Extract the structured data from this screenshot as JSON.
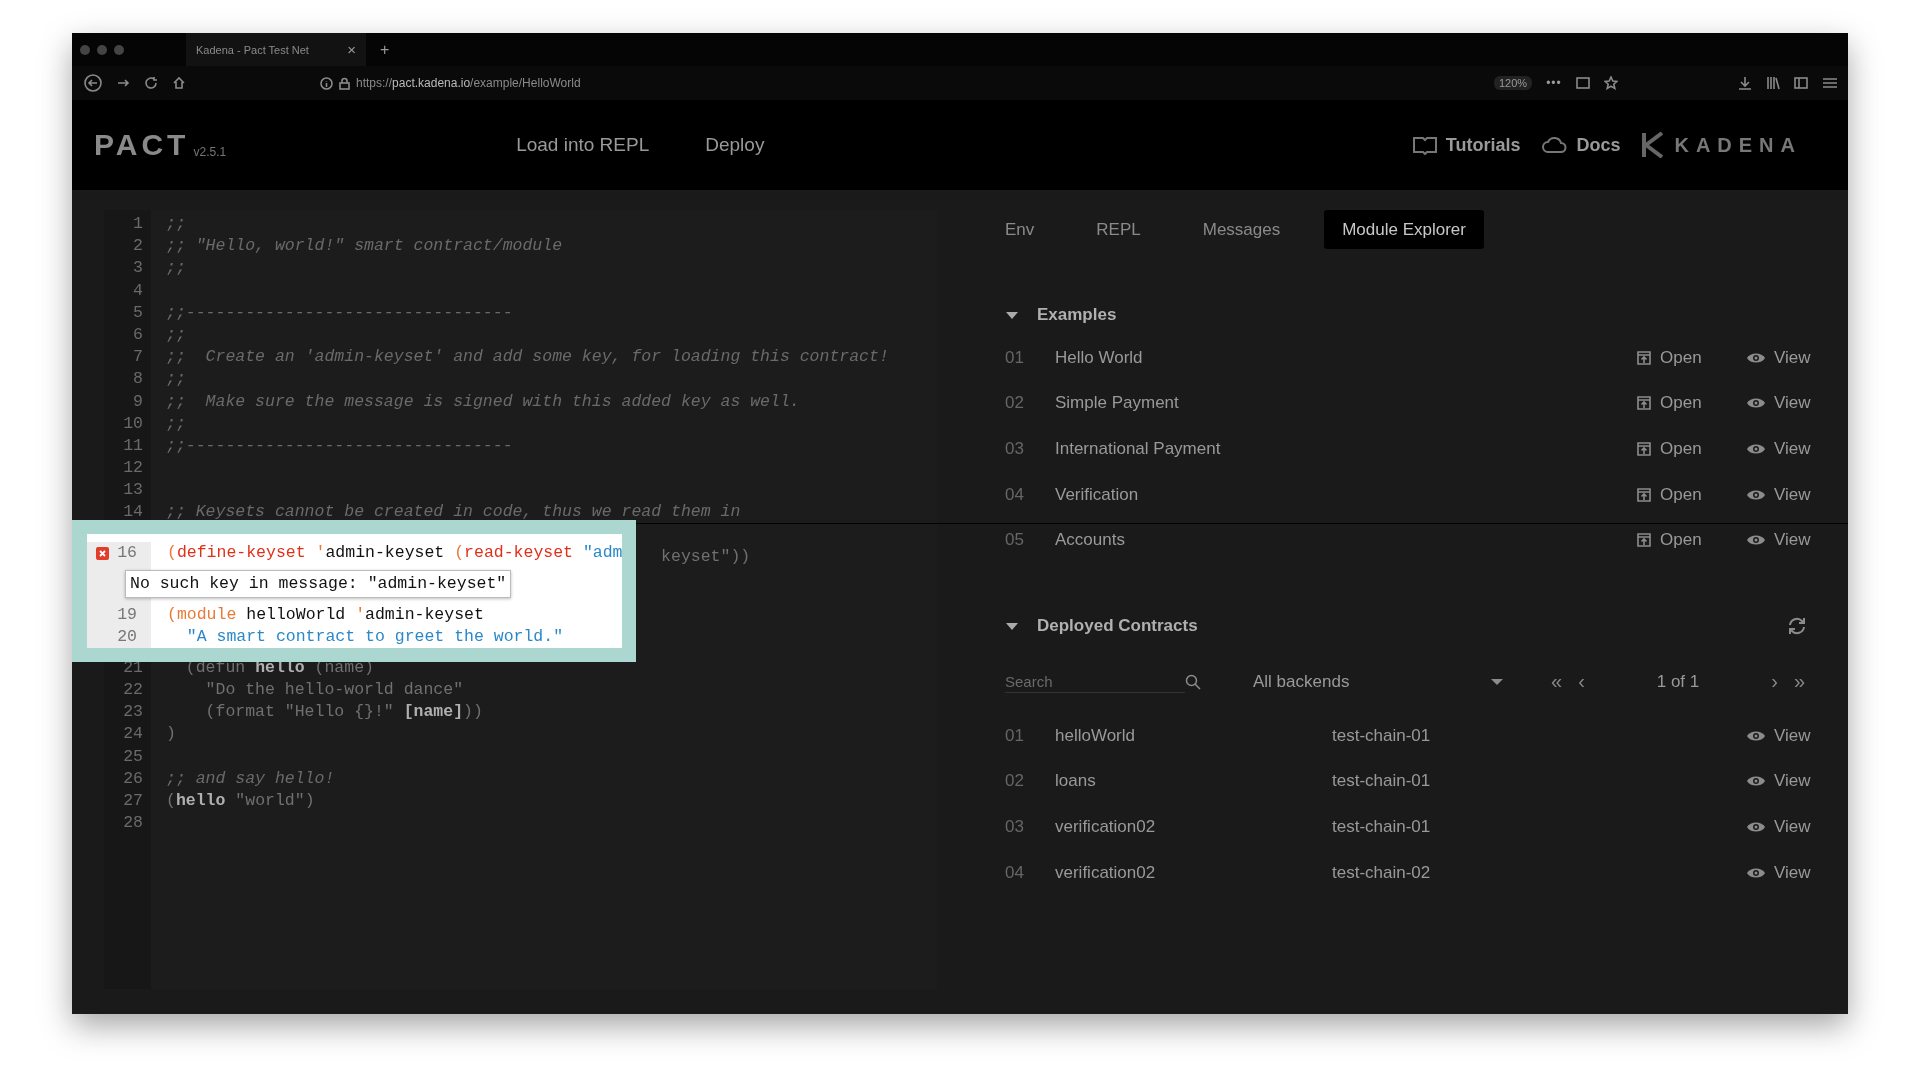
{
  "browser": {
    "tab_title": "Kadena - Pact Test Net",
    "tab_close": "×",
    "new_tab": "+",
    "url": "https://**pact.kadena.io**/example/HelloWorld",
    "zoom": "120%",
    "more": "•••"
  },
  "header": {
    "logo": "PACT",
    "version": "v2.5.1",
    "nav": [
      "Load into REPL",
      "Deploy"
    ],
    "links": [
      "Tutorials",
      "Docs"
    ],
    "brand": "KADENA"
  },
  "editor": {
    "lines_top": [
      {
        "number": "1",
        "segments": [
          {
            "text": ";;",
            "kind": "comment"
          }
        ]
      },
      {
        "number": "2",
        "segments": [
          {
            "text": ";; \"Hello, world!\" smart contract/module",
            "kind": "comment"
          }
        ]
      },
      {
        "number": "3",
        "segments": [
          {
            "text": ";;",
            "kind": "comment"
          }
        ]
      },
      {
        "number": "4"
      },
      {
        "number": "5",
        "segments": [
          {
            "text": ";;---------------------------------",
            "kind": "comment"
          }
        ]
      },
      {
        "number": "6",
        "segments": [
          {
            "text": ";;",
            "kind": "comment"
          }
        ]
      },
      {
        "number": "7",
        "segments": [
          {
            "text": ";;  Create an 'admin-keyset' and add some key, for loading this contract!",
            "kind": "comment"
          }
        ]
      },
      {
        "number": "8",
        "segments": [
          {
            "text": ";;",
            "kind": "comment"
          }
        ]
      },
      {
        "number": "9",
        "segments": [
          {
            "text": ";;  Make sure the message is signed with this added key as well.",
            "kind": "comment"
          }
        ]
      },
      {
        "number": "10",
        "segments": [
          {
            "text": ";;",
            "kind": "comment"
          }
        ]
      },
      {
        "number": "11",
        "segments": [
          {
            "text": ";;---------------------------------",
            "kind": "comment"
          }
        ]
      },
      {
        "number": "12"
      },
      {
        "number": "13"
      },
      {
        "number": "14",
        "segments": [
          {
            "text": ";; Keysets cannot be created in code, thus we read them in",
            "kind": "comment"
          }
        ]
      }
    ],
    "covered_tail": "keyset\"))",
    "lines_bottom": [
      {
        "number": "21",
        "segments": [
          {
            "text": "  (defun ",
            "kind": "plain"
          },
          {
            "text": "hello",
            "kind": "ident"
          },
          {
            "text": " (name)",
            "kind": "plain"
          }
        ]
      },
      {
        "number": "22",
        "segments": [
          {
            "text": "    \"Do the hello-world dance\"",
            "kind": "plain"
          }
        ]
      },
      {
        "number": "23",
        "segments": [
          {
            "text": "    (format \"Hello {}!\" ",
            "kind": "plain"
          },
          {
            "text": "[name]",
            "kind": "ident"
          },
          {
            "text": "))",
            "kind": "plain"
          }
        ]
      },
      {
        "number": "24",
        "segments": [
          {
            "text": ")",
            "kind": "plain"
          }
        ]
      },
      {
        "number": "25"
      },
      {
        "number": "26",
        "segments": [
          {
            "text": ";; and say hello!",
            "kind": "comment"
          }
        ]
      },
      {
        "number": "27",
        "segments": [
          {
            "text": "(",
            "kind": "plain"
          },
          {
            "text": "hello",
            "kind": "ident"
          },
          {
            "text": " \"world\")",
            "kind": "plain"
          }
        ]
      },
      {
        "number": "28"
      }
    ]
  },
  "callout": {
    "lines": [
      {
        "kind": "code",
        "number": "16",
        "error": true,
        "segments": [
          {
            "text": "(",
            "kind": "paren"
          },
          {
            "text": "define-keyset",
            "kind": "keyword"
          },
          {
            "text": " '",
            "kind": "paren"
          },
          {
            "text": "admin-keyset ",
            "kind": "plain"
          },
          {
            "text": "(",
            "kind": "paren"
          },
          {
            "text": "read-keyset",
            "kind": "keyword"
          },
          {
            "text": " \"adm",
            "kind": "string"
          }
        ]
      },
      {
        "kind": "tooltip",
        "text": "No such key in message: \"admin-keyset\""
      },
      {
        "kind": "code",
        "number": "19",
        "error": false,
        "segments": [
          {
            "text": "(",
            "kind": "paren"
          },
          {
            "text": "module",
            "kind": "paren"
          },
          {
            "text": " helloWorld ",
            "kind": "plain"
          },
          {
            "text": "'",
            "kind": "paren"
          },
          {
            "text": "admin-keyset",
            "kind": "plain"
          }
        ]
      },
      {
        "kind": "code",
        "number": "20",
        "error": false,
        "segments": [
          {
            "text": "  \"A smart contract to greet the world.\"",
            "kind": "string"
          }
        ]
      }
    ]
  },
  "panel": {
    "tabs": [
      {
        "label": "Env",
        "selected": false
      },
      {
        "label": "REPL",
        "selected": false
      },
      {
        "label": "Messages",
        "selected": false
      },
      {
        "label": "Module Explorer",
        "selected": true
      }
    ],
    "examples": {
      "title": "Examples",
      "expanded": true,
      "rows": [
        {
          "number": "01",
          "name": "Hello World",
          "open": "Open",
          "view": "View"
        },
        {
          "number": "02",
          "name": "Simple Payment",
          "open": "Open",
          "view": "View"
        },
        {
          "number": "03",
          "name": "International Payment",
          "open": "Open",
          "view": "View"
        },
        {
          "number": "04",
          "name": "Verification",
          "open": "Open",
          "view": "View"
        },
        {
          "number": "05",
          "name": "Accounts",
          "open": "Open",
          "view": "View"
        }
      ]
    },
    "deployed": {
      "title": "Deployed Contracts",
      "expanded": true,
      "search": {
        "placeholder": "Search"
      },
      "backend": "All backends",
      "pager": {
        "first": "«",
        "prev": "‹",
        "status": "1 of 1",
        "next": "›",
        "last": "»"
      },
      "rows": [
        {
          "number": "01",
          "name": "helloWorld",
          "chain": "test-chain-01",
          "view": "View"
        },
        {
          "number": "02",
          "name": "loans",
          "chain": "test-chain-01",
          "view": "View"
        },
        {
          "number": "03",
          "name": "verification02",
          "chain": "test-chain-01",
          "view": "View"
        },
        {
          "number": "04",
          "name": "verification02",
          "chain": "test-chain-02",
          "view": "View"
        }
      ]
    }
  }
}
